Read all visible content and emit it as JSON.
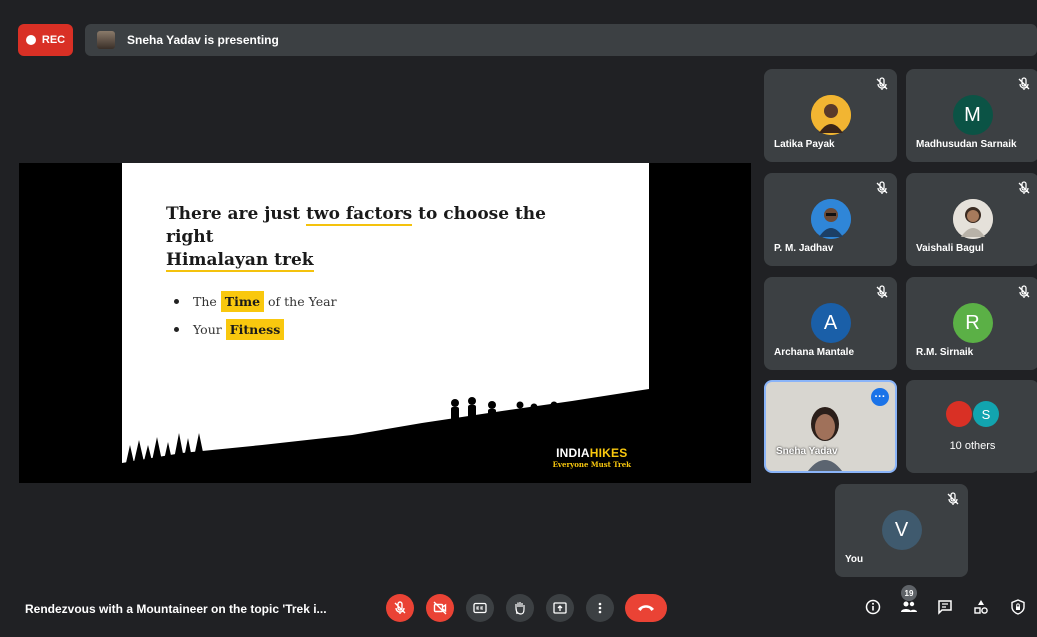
{
  "recording": {
    "label": "REC"
  },
  "presenting_bar": {
    "text": "Sneha Yadav is presenting"
  },
  "slide": {
    "title_part1": "There are just ",
    "title_highlight": "two factors",
    "title_part2": " to choose the right",
    "title_line2": "Himalayan trek",
    "bullets": [
      {
        "prefix": "The",
        "highlight": "Time",
        "suffix": "of the Year"
      },
      {
        "prefix": "Your",
        "highlight": "Fitness",
        "suffix": ""
      }
    ],
    "brand_name_a": "INDIA",
    "brand_name_b": "HIKES",
    "brand_tagline": "Everyone Must Trek"
  },
  "participants": [
    {
      "name": "Latika Payak",
      "initial": "",
      "color": "#f4b400",
      "muted": true
    },
    {
      "name": "Madhusudan Sarnaik",
      "initial": "M",
      "color": "#0b5345",
      "muted": true
    },
    {
      "name": "P. M. Jadhav",
      "initial": "",
      "color": "#2a7fd4",
      "muted": true
    },
    {
      "name": "Vaishali Bagul",
      "initial": "",
      "color": "#cfc9bf",
      "muted": true
    },
    {
      "name": "Archana Mantale",
      "initial": "A",
      "color": "#1a5fa8",
      "muted": true
    },
    {
      "name": "R.M. Sirnaik",
      "initial": "R",
      "color": "#5bb046",
      "muted": true
    }
  ],
  "self_video": {
    "name": "Sneha Yadav",
    "more_icon": "more-horiz-icon"
  },
  "others": {
    "label": "10 others",
    "initial": "S"
  },
  "you_tile": {
    "name": "You",
    "initial": "V",
    "color": "#3f5a6e"
  },
  "bottom": {
    "meeting_title": "Rendezvous with a Mountaineer on the topic 'Trek i...",
    "people_count": "19"
  },
  "colors": {
    "background": "#202124",
    "tile": "#3c4043",
    "danger": "#ea4335",
    "accent": "#f9c80e"
  }
}
